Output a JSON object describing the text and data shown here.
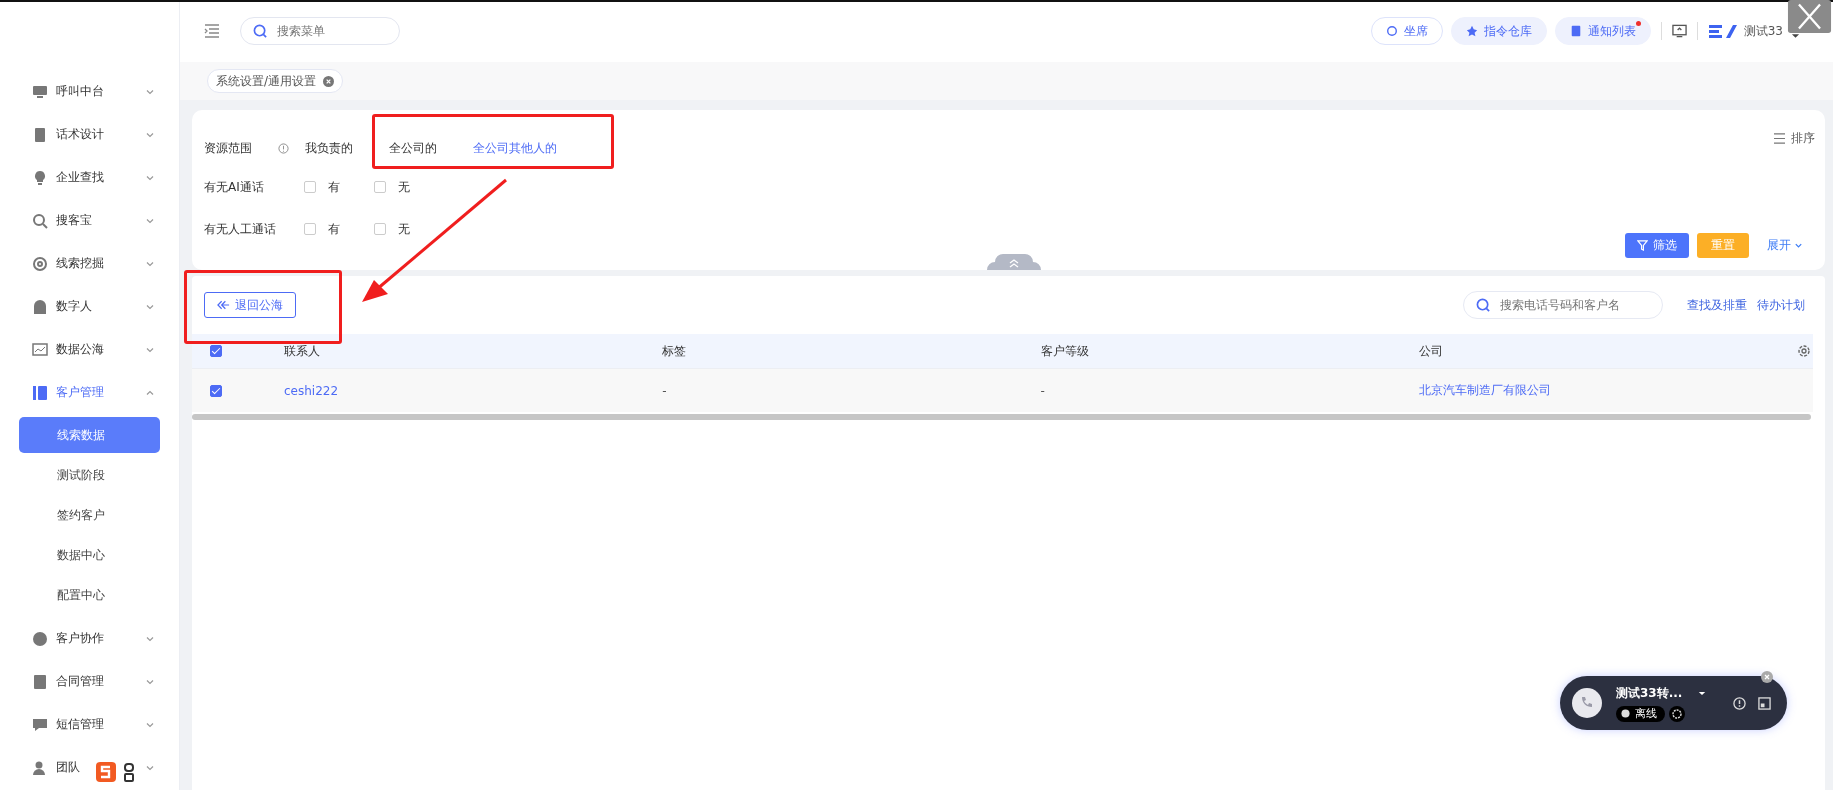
{
  "sidebar": {
    "items": [
      {
        "label": "呼叫中台",
        "expanded": false
      },
      {
        "label": "话术设计",
        "expanded": false
      },
      {
        "label": "企业查找",
        "expanded": false
      },
      {
        "label": "搜客宝",
        "expanded": false
      },
      {
        "label": "线索挖掘",
        "expanded": false
      },
      {
        "label": "数字人",
        "expanded": false
      },
      {
        "label": "数据公海",
        "expanded": false
      },
      {
        "label": "客户管理",
        "expanded": true,
        "children": [
          {
            "label": "线索数据",
            "selected": true
          },
          {
            "label": "测试阶段",
            "selected": false
          },
          {
            "label": "签约客户",
            "selected": false
          },
          {
            "label": "数据中心",
            "selected": false
          },
          {
            "label": "配置中心",
            "selected": false
          }
        ]
      },
      {
        "label": "客户协作",
        "expanded": false
      },
      {
        "label": "合同管理",
        "expanded": false
      },
      {
        "label": "短信管理",
        "expanded": false
      },
      {
        "label": "团队",
        "expanded": false
      }
    ]
  },
  "topbar": {
    "search": {
      "placeholder": "搜索菜单"
    },
    "buttons": [
      {
        "label": "坐席",
        "outlined": true,
        "unread": false
      },
      {
        "label": "指令仓库",
        "outlined": false,
        "unread": false
      },
      {
        "label": "通知列表",
        "outlined": false,
        "unread": true
      }
    ],
    "user": "测试33"
  },
  "tags": [
    {
      "label": "系统设置/通用设置"
    }
  ],
  "filters": {
    "rows": [
      {
        "label": "资源范围",
        "kind": "options",
        "options": [
          {
            "label": "我负责的",
            "selected": false
          },
          {
            "label": "全公司的",
            "selected": false
          },
          {
            "label": "全公司其他人的",
            "selected": true
          }
        ]
      },
      {
        "label": "有无AI通话",
        "kind": "checkboxes",
        "options": [
          {
            "label": "有",
            "checked": false
          },
          {
            "label": "无",
            "checked": false
          }
        ]
      },
      {
        "label": "有无人工通话",
        "kind": "checkboxes",
        "options": [
          {
            "label": "有",
            "checked": false
          },
          {
            "label": "无",
            "checked": false
          }
        ]
      }
    ],
    "sort": "排序",
    "filter_button": "筛选",
    "reset_button": "重置",
    "expand": "展开"
  },
  "toolbar": {
    "return_button": "退回公海",
    "search": {
      "placeholder": "搜索电话号码和客户名"
    },
    "links": [
      "查找及排重",
      "待办计划"
    ]
  },
  "table": {
    "header_checked": true,
    "columns": [
      "联系人",
      "标签",
      "客户等级",
      "公司"
    ],
    "rows": [
      {
        "checked": true,
        "cells": [
          {
            "text": "ceshi222",
            "link": true
          },
          {
            "text": "-",
            "link": false
          },
          {
            "text": "-",
            "link": false
          },
          {
            "text": "北京汽车制造厂有限公司",
            "link": true
          }
        ]
      }
    ]
  },
  "call_widget": {
    "name": "测试33转...",
    "status": "离线"
  }
}
